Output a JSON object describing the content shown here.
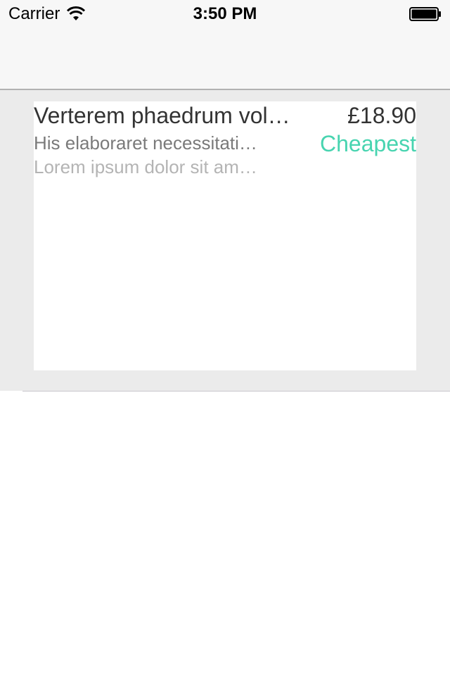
{
  "status_bar": {
    "carrier": "Carrier",
    "time": "3:50 PM",
    "wifi_icon": "wifi-icon",
    "battery_icon": "battery-icon"
  },
  "list": {
    "items": [
      {
        "title": "Verterem phaedrum vol…",
        "price": "£18.90",
        "subtitle": "His elaboraret necessitati…",
        "badge": "Cheapest",
        "description": "Lorem ipsum dolor sit am…"
      }
    ]
  },
  "colors": {
    "accent": "#48d4b0",
    "cell_background": "#ebebeb",
    "nav_background": "#f7f7f7"
  }
}
